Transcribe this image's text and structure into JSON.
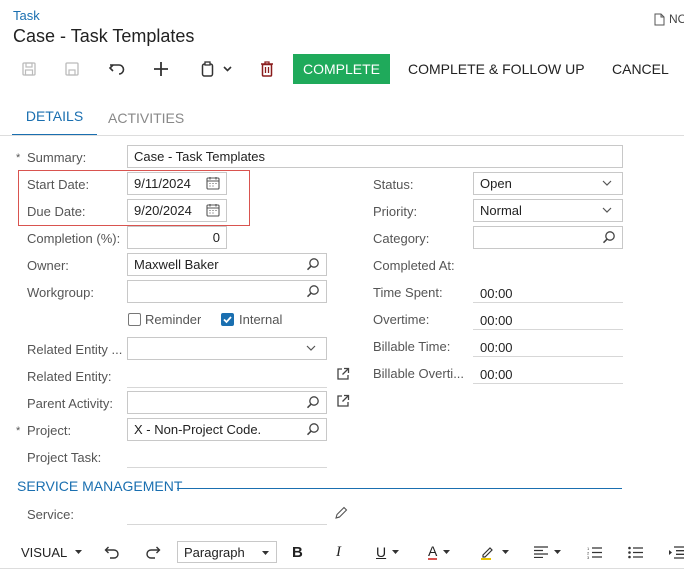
{
  "header": {
    "breadcrumb": "Task",
    "title": "Case - Task Templates",
    "notes_label": "NOTES"
  },
  "toolbar": {
    "complete_label": "COMPLETE",
    "complete_follow_up_label": "COMPLETE & FOLLOW UP",
    "cancel_label": "CANCEL"
  },
  "tabs": [
    {
      "label": "DETAILS",
      "active": true
    },
    {
      "label": "ACTIVITIES",
      "active": false
    }
  ],
  "form": {
    "summary": {
      "label": "Summary:",
      "value": "Case - Task Templates",
      "required": true
    },
    "start_date": {
      "label": "Start Date:",
      "value": "9/11/2024"
    },
    "due_date": {
      "label": "Due Date:",
      "value": "9/20/2024"
    },
    "completion": {
      "label": "Completion (%):",
      "value": "0"
    },
    "owner": {
      "label": "Owner:",
      "value": "Maxwell Baker"
    },
    "workgroup": {
      "label": "Workgroup:",
      "value": ""
    },
    "reminder": {
      "label": "Reminder",
      "checked": false
    },
    "internal": {
      "label": "Internal",
      "checked": true
    },
    "related_entity_type": {
      "label": "Related Entity ...",
      "value": ""
    },
    "related_entity": {
      "label": "Related Entity:",
      "value": ""
    },
    "parent_activity": {
      "label": "Parent Activity:",
      "value": ""
    },
    "project": {
      "label": "Project:",
      "value": "X - Non-Project Code.",
      "required": true
    },
    "project_task": {
      "label": "Project Task:",
      "value": ""
    },
    "status": {
      "label": "Status:",
      "value": "Open"
    },
    "priority": {
      "label": "Priority:",
      "value": "Normal"
    },
    "category": {
      "label": "Category:",
      "value": ""
    },
    "completed_at": {
      "label": "Completed At:",
      "value": ""
    },
    "time_spent": {
      "label": "Time Spent:",
      "value": "00:00"
    },
    "overtime": {
      "label": "Overtime:",
      "value": "00:00"
    },
    "billable_time": {
      "label": "Billable Time:",
      "value": "00:00"
    },
    "billable_overtime": {
      "label": "Billable Overti...",
      "value": "00:00"
    }
  },
  "service_management": {
    "section_label": "SERVICE MANAGEMENT",
    "service": {
      "label": "Service:",
      "value": ""
    }
  },
  "editor": {
    "mode_label": "VISUAL",
    "paragraph_label": "Paragraph"
  },
  "colors": {
    "accent": "#1a6fb0",
    "complete_button": "#1faa5b",
    "highlight_box": "#d9534f"
  }
}
